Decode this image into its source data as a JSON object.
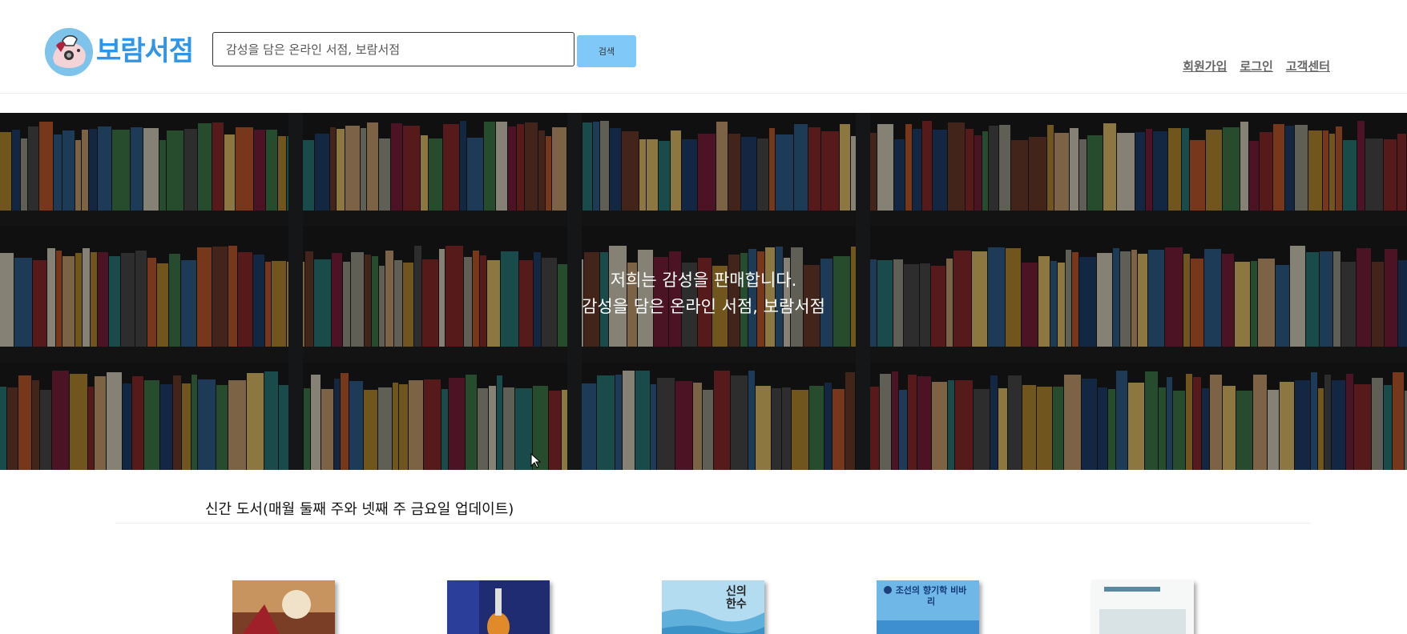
{
  "header": {
    "site_title": "보람서점",
    "search": {
      "placeholder": "감성을 담은 온라인 서점, 보람서점",
      "value": "",
      "button_label": "검색"
    },
    "links": [
      {
        "label": "회원가입"
      },
      {
        "label": "로그인"
      },
      {
        "label": "고객센터"
      }
    ]
  },
  "hero": {
    "line1": "저희는 감성을 판매합니다.",
    "line2": "감성을 담은 온라인 서점, 보람서점"
  },
  "new_books": {
    "title": "신간 도서(매월 둘째 주와 넷째 주 금요일 업데이트)",
    "covers": [
      {
        "text": "",
        "color": "#8a5a3a"
      },
      {
        "text": "",
        "color": "#1e2a6e"
      },
      {
        "text": "신의 한수",
        "color": "#a8d4ec"
      },
      {
        "text": "조선의 향기학 비바리",
        "color": "#5aa8e0"
      },
      {
        "text": "",
        "color": "#f2f4f4"
      }
    ]
  },
  "colors": {
    "brand": "#2f95e6",
    "search_button": "#7fc8f8"
  }
}
